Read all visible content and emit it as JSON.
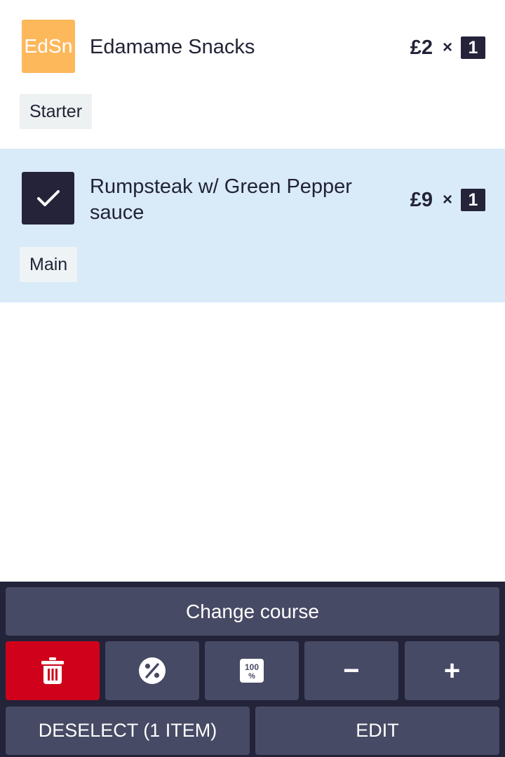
{
  "items": [
    {
      "thumb_text": "EdSn",
      "name": "Edamame Snacks",
      "price": "£2",
      "times": "×",
      "qty": "1",
      "course": "Starter",
      "selected": false,
      "thumb_color": "#fdb85c"
    },
    {
      "name": "Rumpsteak w/ Green Pepper sauce",
      "price": "£9",
      "times": "×",
      "qty": "1",
      "course": "Main",
      "selected": true,
      "thumb_icon": "checkmark-icon"
    }
  ],
  "actions": {
    "change_course": "Change course",
    "delete_icon": "trash-icon",
    "discount_icon": "percent-discount-icon",
    "comp_icon": "100-percent-icon",
    "minus": "−",
    "plus": "+",
    "deselect": "DESELECT (1 ITEM)",
    "edit": "EDIT"
  },
  "colors": {
    "selected_row_bg": "#d9eaf8",
    "panel_bg": "#23233a",
    "button_bg": "#474a64",
    "delete_bg": "#d0021b"
  }
}
